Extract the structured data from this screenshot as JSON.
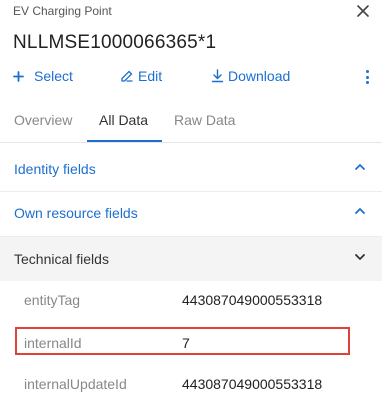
{
  "header": {
    "subtitle": "EV Charging Point",
    "title": "NLLMSE1000066365*1",
    "close_icon": "close-icon"
  },
  "toolbar": {
    "select_label": "Select",
    "edit_label": "Edit",
    "download_label": "Download",
    "select_icon": "plus-icon",
    "edit_icon": "edit-icon",
    "download_icon": "download-icon",
    "more_icon": "kebab-menu-icon"
  },
  "tabs": [
    {
      "label": "Overview",
      "active": false
    },
    {
      "label": "All Data",
      "active": true
    },
    {
      "label": "Raw Data",
      "active": false
    }
  ],
  "sections": [
    {
      "label": "Identity fields",
      "expanded": false
    },
    {
      "label": "Own resource fields",
      "expanded": false
    },
    {
      "label": "Technical fields",
      "expanded": true
    }
  ],
  "technical_fields": [
    {
      "label": "entityTag",
      "value": "443087049000553318"
    },
    {
      "label": "internalId",
      "value": "7"
    },
    {
      "label": "internalUpdateId",
      "value": "443087049000553318"
    }
  ],
  "colors": {
    "accent": "#1c6fd1",
    "highlight": "#e0423b",
    "section_bg": "#f4f4f4"
  }
}
